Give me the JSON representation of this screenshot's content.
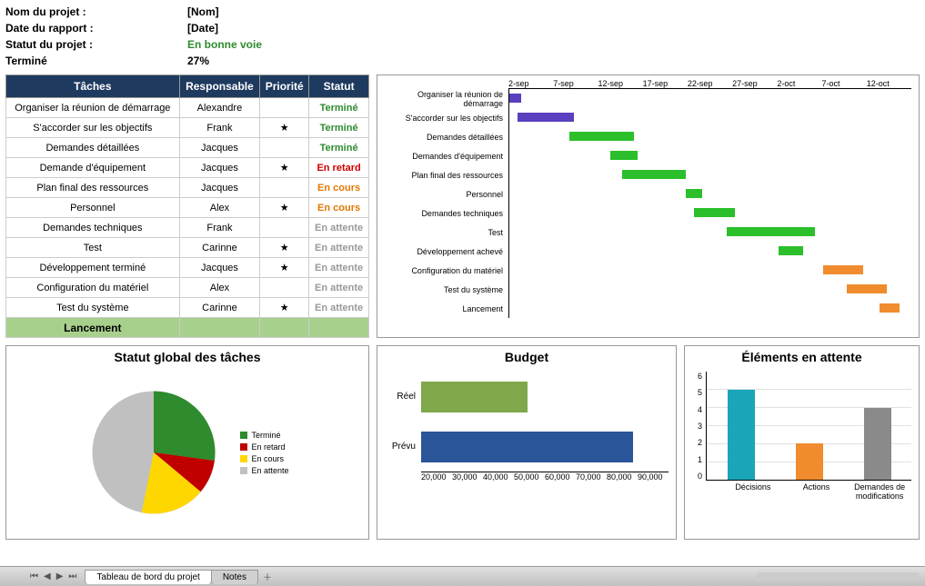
{
  "info": {
    "name_label": "Nom du projet :",
    "name_value": "[Nom]",
    "date_label": "Date du rapport :",
    "date_value": "[Date]",
    "status_label": "Statut du projet :",
    "status_value": "En bonne voie",
    "done_label": "Terminé",
    "done_value": "27%"
  },
  "tasks": {
    "headers": {
      "task": "Tâches",
      "owner": "Responsable",
      "priority": "Priorité",
      "status": "Statut"
    },
    "rows": [
      {
        "task": "Organiser la réunion de démarrage",
        "owner": "Alexandre",
        "priority": "",
        "status": "Terminé",
        "cls": "st-termine"
      },
      {
        "task": "S'accorder sur les objectifs",
        "owner": "Frank",
        "priority": "★",
        "status": "Terminé",
        "cls": "st-termine"
      },
      {
        "task": "Demandes détaillées",
        "owner": "Jacques",
        "priority": "",
        "status": "Terminé",
        "cls": "st-termine"
      },
      {
        "task": "Demande d'équipement",
        "owner": "Jacques",
        "priority": "★",
        "status": "En retard",
        "cls": "st-retard"
      },
      {
        "task": "Plan final des ressources",
        "owner": "Jacques",
        "priority": "",
        "status": "En cours",
        "cls": "st-cours"
      },
      {
        "task": "Personnel",
        "owner": "Alex",
        "priority": "★",
        "status": "En cours",
        "cls": "st-cours"
      },
      {
        "task": "Demandes techniques",
        "owner": "Frank",
        "priority": "",
        "status": "En attente",
        "cls": "st-attente"
      },
      {
        "task": "Test",
        "owner": "Carinne",
        "priority": "★",
        "status": "En attente",
        "cls": "st-attente"
      },
      {
        "task": "Développement terminé",
        "owner": "Jacques",
        "priority": "★",
        "status": "En attente",
        "cls": "st-attente"
      },
      {
        "task": "Configuration du matériel",
        "owner": "Alex",
        "priority": "",
        "status": "En attente",
        "cls": "st-attente"
      },
      {
        "task": "Test du système",
        "owner": "Carinne",
        "priority": "★",
        "status": "En attente",
        "cls": "st-attente"
      }
    ],
    "launch": "Lancement"
  },
  "gantt": {
    "ticks": [
      "2-sep",
      "7-sep",
      "12-sep",
      "17-sep",
      "22-sep",
      "27-sep",
      "2-oct",
      "7-oct",
      "12-oct"
    ],
    "rows": [
      {
        "label": "Organiser la réunion de démarrage",
        "start": 0,
        "width": 3,
        "color": "g-purple"
      },
      {
        "label": "S'accorder sur les objectifs",
        "start": 2,
        "width": 14,
        "color": "g-purple"
      },
      {
        "label": "Demandes détaillées",
        "start": 15,
        "width": 16,
        "color": "g-green"
      },
      {
        "label": "Demandes d'équipement",
        "start": 25,
        "width": 7,
        "color": "g-green"
      },
      {
        "label": "Plan final des ressources",
        "start": 28,
        "width": 16,
        "color": "g-green"
      },
      {
        "label": "Personnel",
        "start": 44,
        "width": 4,
        "color": "g-green"
      },
      {
        "label": "Demandes techniques",
        "start": 46,
        "width": 10,
        "color": "g-green"
      },
      {
        "label": "Test",
        "start": 54,
        "width": 22,
        "color": "g-green"
      },
      {
        "label": "Développement achevé",
        "start": 67,
        "width": 6,
        "color": "g-green"
      },
      {
        "label": "Configuration du matériel",
        "start": 78,
        "width": 10,
        "color": "g-orange"
      },
      {
        "label": "Test du système",
        "start": 84,
        "width": 10,
        "color": "g-orange"
      },
      {
        "label": "Lancement",
        "start": 92,
        "width": 5,
        "color": "g-orange"
      }
    ]
  },
  "pie": {
    "title": "Statut global des tâches",
    "legend": [
      {
        "label": "Terminé",
        "color": "#2e8b2e"
      },
      {
        "label": "En retard",
        "color": "#c00000"
      },
      {
        "label": "En cours",
        "color": "#ffd700"
      },
      {
        "label": "En attente",
        "color": "#c0c0c0"
      }
    ]
  },
  "budget": {
    "title": "Budget",
    "rows": [
      {
        "label": "Réel",
        "value": 50000,
        "color": "#7fa84a"
      },
      {
        "label": "Prévu",
        "value": 80000,
        "color": "#2a5599"
      }
    ],
    "ticks": [
      "20,000",
      "30,000",
      "40,000",
      "50,000",
      "60,000",
      "70,000",
      "80,000",
      "90,000"
    ]
  },
  "pending": {
    "title": "Éléments en attente",
    "yticks": [
      "6",
      "5",
      "4",
      "3",
      "2",
      "1",
      "0"
    ],
    "bars": [
      {
        "label": "Décisions",
        "value": 5,
        "color": "#1aa5b8"
      },
      {
        "label": "Actions",
        "value": 2,
        "color": "#f08c2e"
      },
      {
        "label": "Demandes de modifications",
        "value": 4,
        "color": "#8a8a8a"
      }
    ]
  },
  "tabs": {
    "active": "Tableau de bord du projet",
    "other": "Notes"
  },
  "chart_data": [
    {
      "type": "pie",
      "title": "Statut global des tâches",
      "categories": [
        "Terminé",
        "En retard",
        "En cours",
        "En attente"
      ],
      "values": [
        27,
        9,
        18,
        46
      ]
    },
    {
      "type": "bar",
      "title": "Budget",
      "categories": [
        "Réel",
        "Prévu"
      ],
      "values": [
        50000,
        80000
      ],
      "xlabel": "",
      "ylabel": "",
      "xlim": [
        20000,
        90000
      ],
      "orientation": "horizontal"
    },
    {
      "type": "bar",
      "title": "Éléments en attente",
      "categories": [
        "Décisions",
        "Actions",
        "Demandes de modifications"
      ],
      "values": [
        5,
        2,
        4
      ],
      "ylim": [
        0,
        6
      ]
    },
    {
      "type": "gantt",
      "title": "",
      "x_ticks": [
        "2-sep",
        "7-sep",
        "12-sep",
        "17-sep",
        "22-sep",
        "27-sep",
        "2-oct",
        "7-oct",
        "12-oct"
      ],
      "tasks": [
        {
          "name": "Organiser la réunion de démarrage",
          "start": "2-sep",
          "end": "3-sep",
          "status": "done"
        },
        {
          "name": "S'accorder sur les objectifs",
          "start": "3-sep",
          "end": "8-sep",
          "status": "done"
        },
        {
          "name": "Demandes détaillées",
          "start": "8-sep",
          "end": "14-sep",
          "status": "active"
        },
        {
          "name": "Demandes d'équipement",
          "start": "12-sep",
          "end": "14-sep",
          "status": "active"
        },
        {
          "name": "Plan final des ressources",
          "start": "13-sep",
          "end": "19-sep",
          "status": "active"
        },
        {
          "name": "Personnel",
          "start": "19-sep",
          "end": "21-sep",
          "status": "active"
        },
        {
          "name": "Demandes techniques",
          "start": "20-sep",
          "end": "24-sep",
          "status": "active"
        },
        {
          "name": "Test",
          "start": "23-sep",
          "end": "2-oct",
          "status": "active"
        },
        {
          "name": "Développement achevé",
          "start": "29-sep",
          "end": "1-oct",
          "status": "active"
        },
        {
          "name": "Configuration du matériel",
          "start": "3-oct",
          "end": "7-oct",
          "status": "future"
        },
        {
          "name": "Test du système",
          "start": "6-oct",
          "end": "10-oct",
          "status": "future"
        },
        {
          "name": "Lancement",
          "start": "9-oct",
          "end": "11-oct",
          "status": "future"
        }
      ]
    }
  ]
}
